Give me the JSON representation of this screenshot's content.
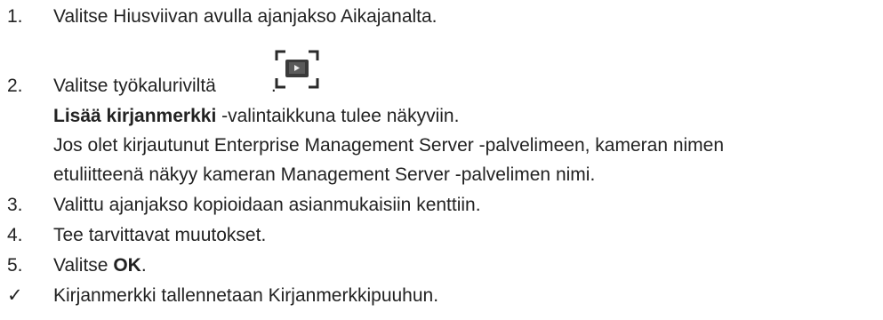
{
  "steps": [
    {
      "num": "1.",
      "text": "Valitse Hiusviivan avulla ajanjakso Aikajanalta."
    },
    {
      "num": "2.",
      "text_before_icon": "Valitse työkaluriviltä",
      "text_after_icon": ".",
      "icon": "bookmark-icon"
    },
    {
      "num": "",
      "bold": "Lisää kirjanmerkki",
      "rest": " -valintaikkuna tulee näkyviin."
    },
    {
      "num": "",
      "text": "Jos olet kirjautunut Enterprise Management Server -palvelimeen, kameran nimen"
    },
    {
      "num": "",
      "text": "etuliitteenä näkyy kameran Management Server -palvelimen nimi."
    },
    {
      "num": "3.",
      "text": "Valittu ajanjakso kopioidaan asianmukaisiin kenttiin."
    },
    {
      "num": "4.",
      "text": "Tee tarvittavat muutokset."
    },
    {
      "num": "5.",
      "text_before_bold": "Valitse ",
      "bold": "OK",
      "text_after_bold": "."
    }
  ],
  "result": {
    "mark": "✓",
    "text": "Kirjanmerkki tallennetaan Kirjanmerkkipuuhun."
  }
}
